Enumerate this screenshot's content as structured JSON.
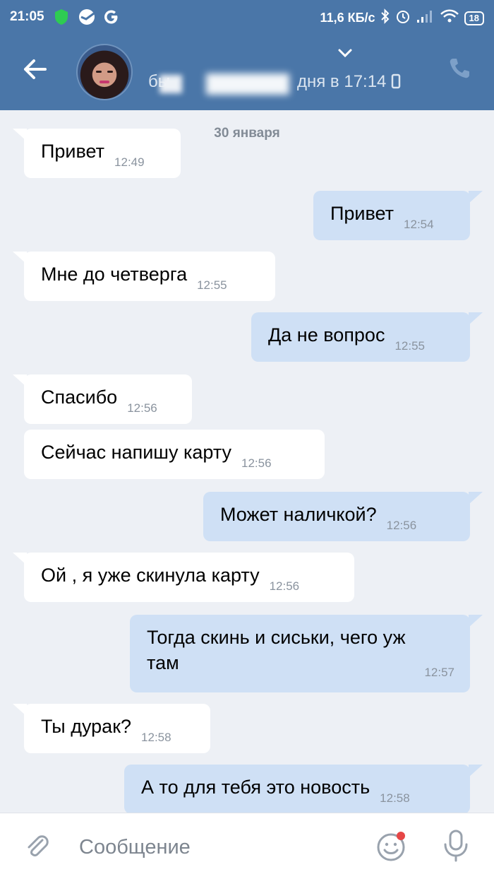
{
  "status_bar": {
    "time": "21:05",
    "speed": "11,6 КБ/с",
    "battery": "18"
  },
  "header": {
    "last_seen_prefix": "бы",
    "last_seen_text": "дня в 17:14"
  },
  "date_separator": "30 января",
  "messages": [
    {
      "direction": "in",
      "text": "Привет",
      "time": "12:49"
    },
    {
      "direction": "out",
      "text": "Привет",
      "time": "12:54"
    },
    {
      "direction": "in",
      "text": "Мне до четверга",
      "time": "12:55"
    },
    {
      "direction": "out",
      "text": "Да не вопрос",
      "time": "12:55"
    },
    {
      "direction": "in",
      "text": "Спасибо",
      "time": "12:56"
    },
    {
      "direction": "in",
      "text": "Сейчас напишу карту",
      "time": "12:56"
    },
    {
      "direction": "out",
      "text": "Может наличкой?",
      "time": "12:56"
    },
    {
      "direction": "in",
      "text": "Ой , я уже скинула карту",
      "time": "12:56"
    },
    {
      "direction": "out",
      "text": "Тогда скинь и сиськи, чего уж там",
      "time": "12:57"
    },
    {
      "direction": "in",
      "text": "Ты дурак?",
      "time": "12:58"
    },
    {
      "direction": "out",
      "text": "А то для тебя это новость",
      "time": "12:58"
    }
  ],
  "composer": {
    "placeholder": "Сообщение"
  },
  "colors": {
    "header_bg": "#4a76a8",
    "chat_bg": "#edf0f5",
    "incoming_bubble": "#ffffff",
    "outgoing_bubble": "#cfe0f5",
    "notification_dot": "#e64646"
  },
  "icons": [
    "shield-icon",
    "sberbank-icon",
    "google-icon",
    "bluetooth-icon",
    "alarm-icon",
    "signal-icon",
    "wifi-icon",
    "battery-icon",
    "back-arrow-icon",
    "chevron-down-icon",
    "phone-icon",
    "paperclip-icon",
    "smiley-icon",
    "microphone-icon"
  ]
}
